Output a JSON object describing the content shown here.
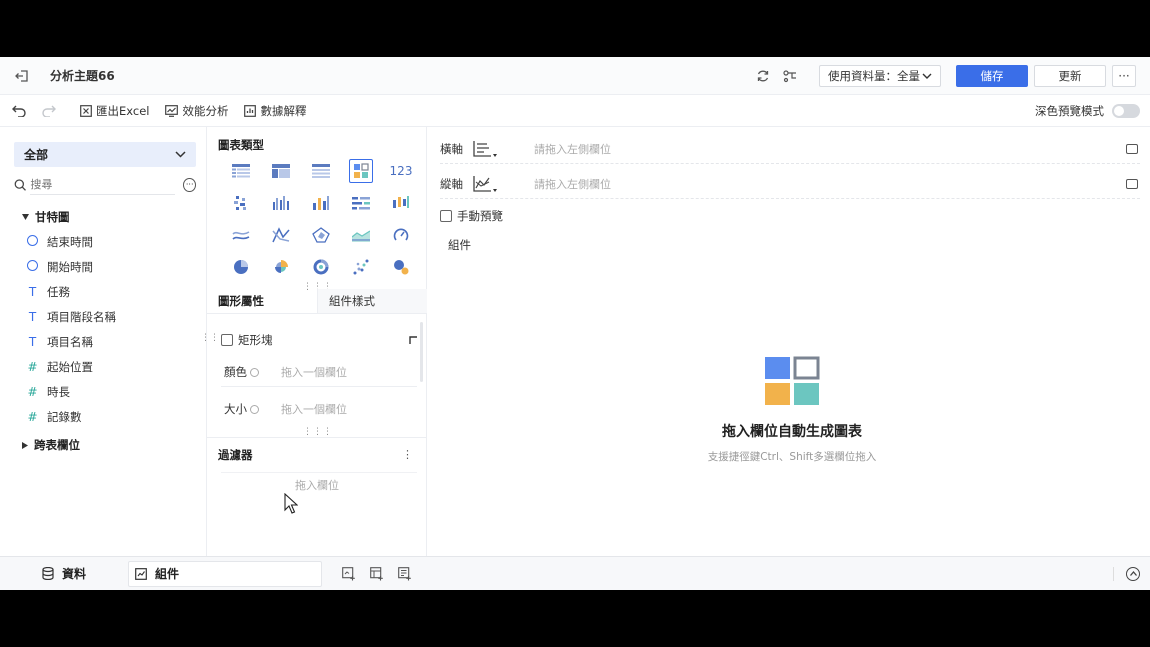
{
  "header": {
    "title": "分析主題66",
    "data_select_label": "使用資料量：全量",
    "save_label": "儲存",
    "update_label": "更新",
    "more_label": "···"
  },
  "toolbar": {
    "export_label": "匯出Excel",
    "perf_label": "效能分析",
    "explain_label": "數據解釋",
    "dark_mode_label": "深色預覽模式"
  },
  "sidebar": {
    "scope_label": "全部",
    "search_placeholder": "搜尋",
    "group_label": "甘特圖",
    "fields": [
      {
        "icon": "clock-icon",
        "label": "結束時間"
      },
      {
        "icon": "clock-icon",
        "label": "開始時間"
      },
      {
        "icon": "text-icon",
        "label": "任務"
      },
      {
        "icon": "text-icon",
        "label": "項目階段名稱"
      },
      {
        "icon": "text-icon",
        "label": "項目名稱"
      },
      {
        "icon": "hash-icon",
        "label": "起始位置"
      },
      {
        "icon": "hash-icon",
        "label": "時長"
      },
      {
        "icon": "hash-icon",
        "label": "記錄數"
      }
    ],
    "cross_table_label": "跨表欄位"
  },
  "middle": {
    "chart_type_title": "圖表類型",
    "tab_props": "圖形屬性",
    "tab_style": "組件樣式",
    "rect_block_label": "矩形塊",
    "color_label": "顏色",
    "color_hint": "拖入一個欄位",
    "size_label": "大小",
    "size_hint": "拖入一個欄位",
    "filter_label": "過濾器",
    "filter_hint": "拖入欄位",
    "kebab": "⋮"
  },
  "canvas": {
    "x_axis_label": "橫軸",
    "x_axis_hint": "請拖入左側欄位",
    "y_axis_label": "縱軸",
    "y_axis_hint": "請拖入左側欄位",
    "manual_preview_label": "手動預覽",
    "component_label": "組件",
    "empty_title": "拖入欄位自動生成圖表",
    "empty_subtitle": "支援捷徑鍵Ctrl、Shift多選欄位拖入"
  },
  "bottombar": {
    "data_tab": "資料",
    "component_tab": "組件"
  },
  "colors": {
    "primary": "#3a6ee8",
    "tile_blue": "#5b8def",
    "tile_orange": "#f2b24b",
    "tile_teal": "#6cc6c0",
    "tile_outline": "#7b8492"
  }
}
